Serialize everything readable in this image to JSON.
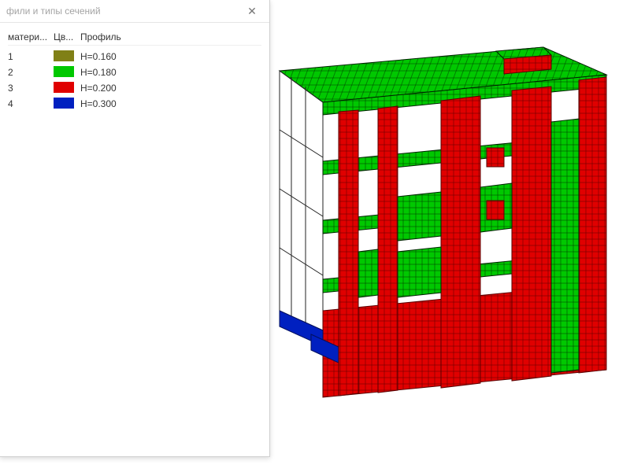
{
  "panel": {
    "title": "фили и типы сечений",
    "columns": {
      "material": "матери...",
      "color": "Цв...",
      "profile": "Профиль"
    },
    "rows": [
      {
        "material": "1",
        "color": "#808016",
        "profile": "H=0.160"
      },
      {
        "material": "2",
        "color": "#00c800",
        "profile": "H=0.180"
      },
      {
        "material": "3",
        "color": "#e00000",
        "profile": "H=0.200"
      },
      {
        "material": "4",
        "color": "#0020c0",
        "profile": "H=0.300"
      }
    ]
  },
  "model": {
    "colors": {
      "slab": "#00c800",
      "wall": "#e00000",
      "base": "#0020c0",
      "mesh": "#003300"
    }
  }
}
